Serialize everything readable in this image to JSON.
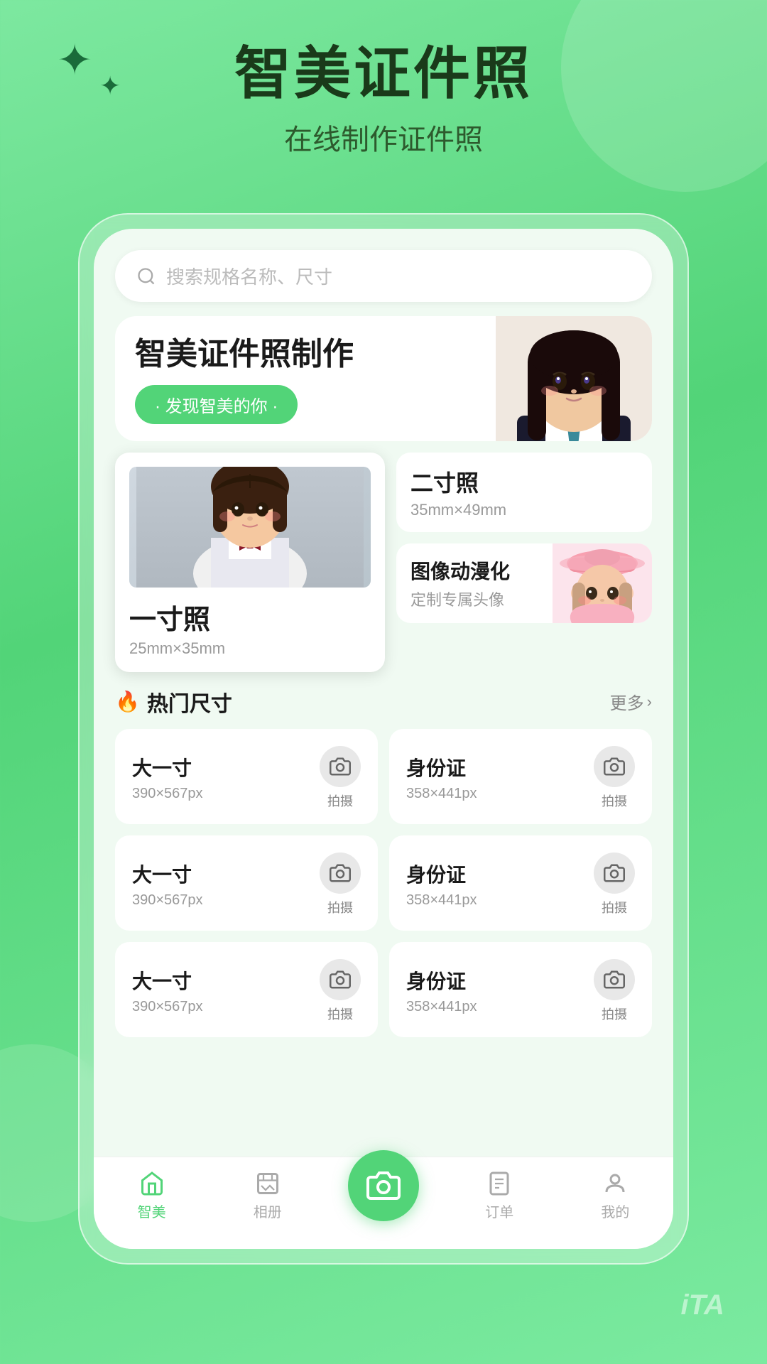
{
  "app": {
    "title": "智美证件照",
    "subtitle": "在线制作证件照"
  },
  "colors": {
    "primary": "#52d478",
    "dark": "#1a3a1a",
    "text": "#1a1a1a",
    "muted": "#999999",
    "white": "#ffffff"
  },
  "search": {
    "placeholder": "搜索规格名称、尺寸"
  },
  "hero": {
    "title": "智美证件照制作",
    "badge": "· 发现智美的你 ·"
  },
  "cards": {
    "yicun": {
      "label": "一寸照",
      "size": "25mm×35mm"
    },
    "ercun": {
      "label": "二寸照",
      "size": "35mm×49mm"
    },
    "anime": {
      "label": "图像动漫化",
      "desc": "定制专属头像"
    }
  },
  "hot_section": {
    "title": "热门尺寸",
    "more_label": "更多"
  },
  "size_items": [
    {
      "name": "大一寸",
      "dim": "390×567px",
      "btn": "拍摄"
    },
    {
      "name": "身份证",
      "dim": "358×441px",
      "btn": "拍摄"
    },
    {
      "name": "大一寸",
      "dim": "390×567px",
      "btn": "拍摄"
    },
    {
      "name": "身份证",
      "dim": "358×441px",
      "btn": "拍摄"
    },
    {
      "name": "大一寸",
      "dim": "390×567px",
      "btn": "拍摄"
    },
    {
      "name": "身份证",
      "dim": "358×441px",
      "btn": "拍摄"
    }
  ],
  "nav": {
    "items": [
      {
        "label": "智美",
        "active": true
      },
      {
        "label": "相册",
        "active": false
      },
      {
        "label": "",
        "active": false,
        "is_camera": true
      },
      {
        "label": "订单",
        "active": false
      },
      {
        "label": "我的",
        "active": false
      }
    ]
  },
  "ita_text": "iTA"
}
